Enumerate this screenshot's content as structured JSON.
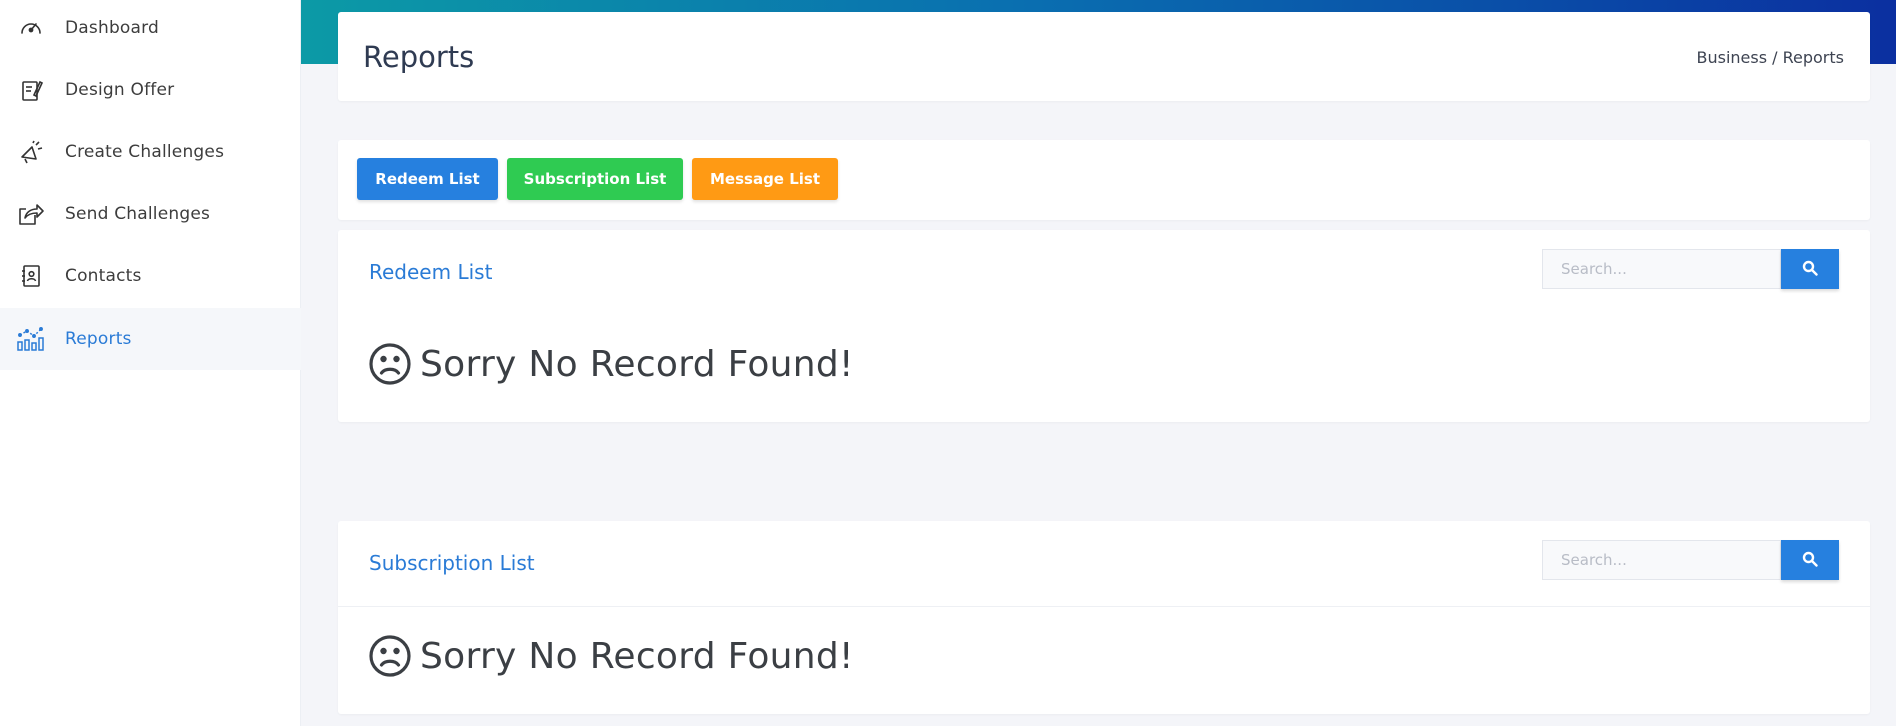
{
  "sidebar": {
    "items": [
      {
        "label": "Dashboard",
        "icon": "speedometer-icon",
        "active": false
      },
      {
        "label": "Design Offer",
        "icon": "design-offer-icon",
        "active": false
      },
      {
        "label": "Create Challenges",
        "icon": "megaphone-icon",
        "active": false
      },
      {
        "label": "Send Challenges",
        "icon": "share-icon",
        "active": false
      },
      {
        "label": "Contacts",
        "icon": "contact-book-icon",
        "active": false
      },
      {
        "label": "Reports",
        "icon": "bar-chart-icon",
        "active": true
      }
    ]
  },
  "header": {
    "title": "Reports",
    "breadcrumb": "Business / Reports"
  },
  "buttons": {
    "redeem": "Redeem List",
    "subscription": "Subscription List",
    "message": "Message List"
  },
  "redeem_section": {
    "title": "Redeem List",
    "search_placeholder": "Search...",
    "empty_message": "Sorry No Record Found!"
  },
  "subscription_section": {
    "title": "Subscription List",
    "search_placeholder": "Search...",
    "empty_message": "Sorry No Record Found!"
  },
  "colors": {
    "accent": "#2680df",
    "green": "#2fcb52",
    "orange": "#ff9a14",
    "active_text": "#2a7bd6"
  }
}
